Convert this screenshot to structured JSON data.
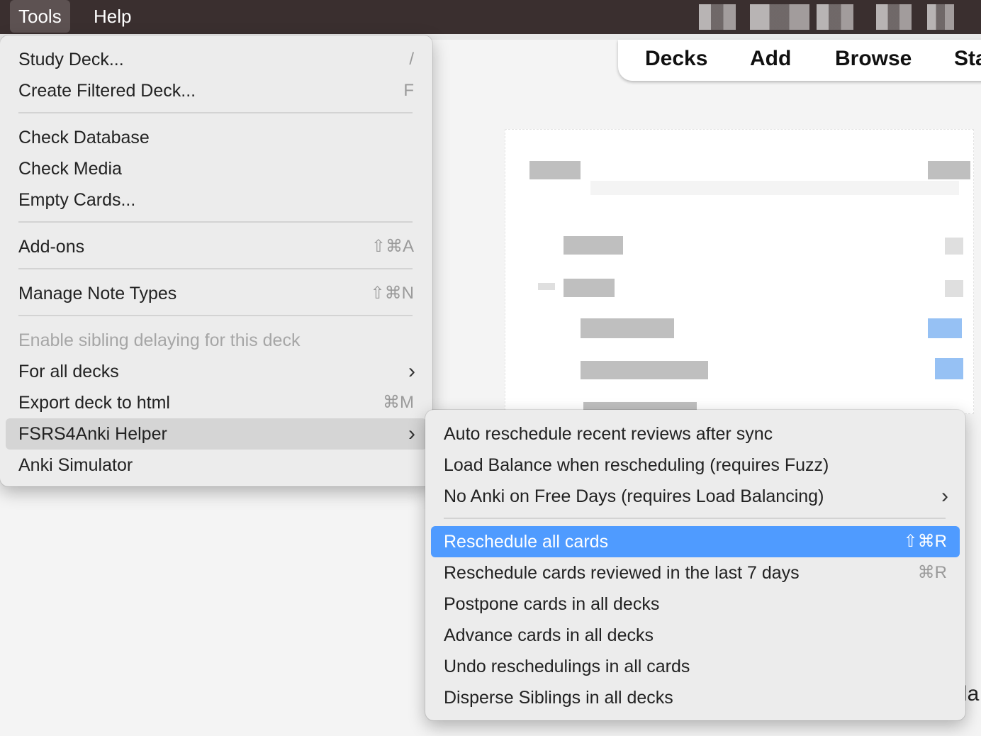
{
  "menubar": {
    "items": [
      {
        "label": "Tools"
      },
      {
        "label": "Help"
      }
    ]
  },
  "toolbar": {
    "tabs": [
      {
        "label": "Decks"
      },
      {
        "label": "Add"
      },
      {
        "label": "Browse"
      },
      {
        "label": "Sta"
      }
    ]
  },
  "background": {
    "fragment_text": "la"
  },
  "tools_menu": {
    "items": [
      {
        "label": "Study Deck...",
        "shortcut": "/"
      },
      {
        "label": "Create Filtered Deck...",
        "shortcut": "F"
      },
      {
        "label": "Check Database",
        "shortcut": ""
      },
      {
        "label": "Check Media",
        "shortcut": ""
      },
      {
        "label": "Empty Cards...",
        "shortcut": ""
      },
      {
        "label": "Add-ons",
        "shortcut": "⇧⌘A"
      },
      {
        "label": "Manage Note Types",
        "shortcut": "⇧⌘N"
      },
      {
        "label": "Enable sibling delaying for this deck",
        "shortcut": ""
      },
      {
        "label": "For all decks",
        "shortcut": "›"
      },
      {
        "label": "Export deck to html",
        "shortcut": "⌘M"
      },
      {
        "label": "FSRS4Anki Helper",
        "shortcut": "›"
      },
      {
        "label": "Anki Simulator",
        "shortcut": ""
      }
    ]
  },
  "submenu": {
    "items": [
      {
        "label": "Auto reschedule recent reviews after sync",
        "shortcut": ""
      },
      {
        "label": "Load Balance when rescheduling (requires Fuzz)",
        "shortcut": ""
      },
      {
        "label": "No Anki on Free Days (requires Load Balancing)",
        "shortcut": "›"
      },
      {
        "label": "Reschedule all cards",
        "shortcut": "⇧⌘R"
      },
      {
        "label": "Reschedule cards reviewed in the last 7 days",
        "shortcut": "⌘R"
      },
      {
        "label": "Postpone cards in all decks",
        "shortcut": ""
      },
      {
        "label": "Advance cards in all decks",
        "shortcut": ""
      },
      {
        "label": "Undo reschedulings in all cards",
        "shortcut": ""
      },
      {
        "label": "Disperse Siblings in all decks",
        "shortcut": ""
      }
    ]
  }
}
